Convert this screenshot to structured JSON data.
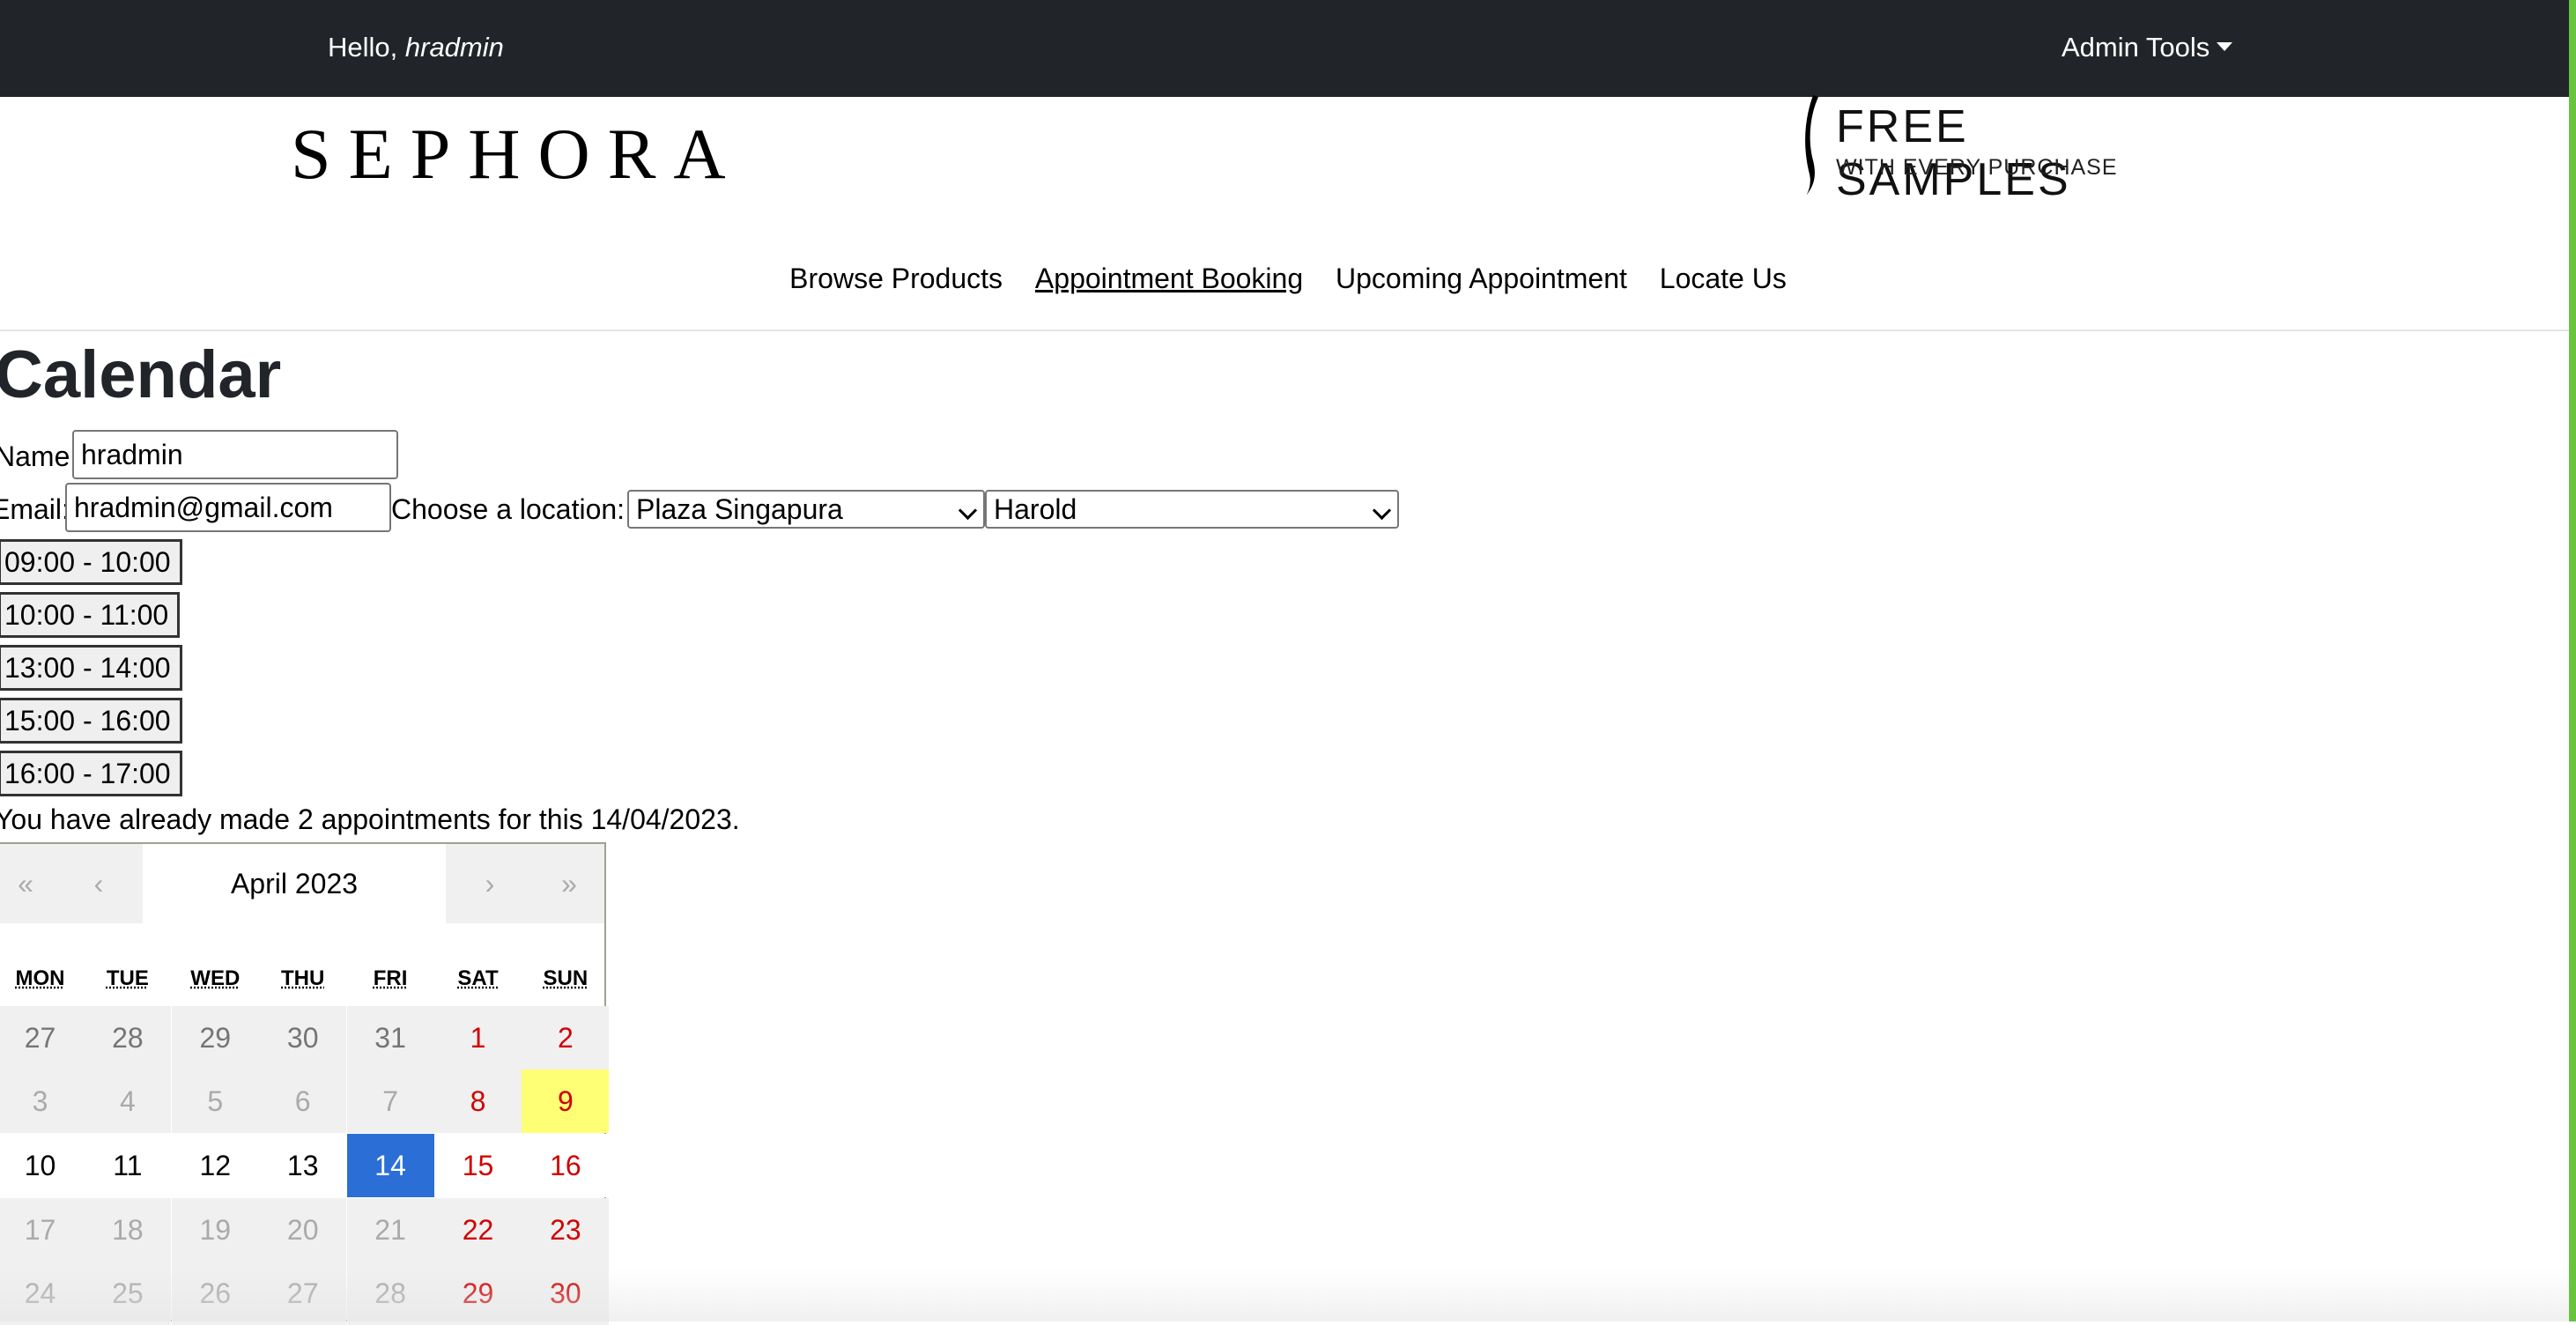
{
  "topbar": {
    "greeting_prefix": "Hello, ",
    "username": "hradmin",
    "admin_tools": "Admin Tools"
  },
  "header": {
    "logo": "SEPHORA",
    "promo_title": "FREE SAMPLES",
    "promo_sub": "WITH EVERY PURCHASE"
  },
  "nav": {
    "items": [
      {
        "label": "Browse Products",
        "active": false
      },
      {
        "label": "Appointment Booking",
        "active": true
      },
      {
        "label": "Upcoming Appointment",
        "active": false
      },
      {
        "label": "Locate Us",
        "active": false
      }
    ]
  },
  "page": {
    "title": "Calendar",
    "name_label": "Name:",
    "name_value": "hradmin",
    "email_label": "Email:",
    "email_value": "hradmin@gmail.com",
    "location_label": "Choose a location:",
    "location_value": "Plaza Singapura",
    "staff_value": "Harold",
    "time_slots": [
      "09:00 - 10:00",
      "10:00 - 11:00",
      "13:00 - 14:00",
      "15:00 - 16:00",
      "16:00 - 17:00"
    ],
    "notice": "You have already made 2 appointments for this 14/04/2023."
  },
  "calendar": {
    "prev2": "«",
    "prev": "‹",
    "label": "April 2023",
    "next": "›",
    "next2": "»",
    "weekdays": [
      "MON",
      "TUE",
      "WED",
      "THU",
      "FRI",
      "SAT",
      "SUN"
    ],
    "weeks": [
      [
        "27",
        "28",
        "29",
        "30",
        "31",
        "1",
        "2"
      ],
      [
        "3",
        "4",
        "5",
        "6",
        "7",
        "8",
        "9"
      ],
      [
        "10",
        "11",
        "12",
        "13",
        "14",
        "15",
        "16"
      ],
      [
        "17",
        "18",
        "19",
        "20",
        "21",
        "22",
        "23"
      ],
      [
        "24",
        "25",
        "26",
        "27",
        "28",
        "29",
        "30"
      ]
    ],
    "today": "9",
    "selected": "14",
    "colors": {
      "selected": "#2b6fd6",
      "today": "#ffff76",
      "weekend": "#d10000"
    }
  }
}
